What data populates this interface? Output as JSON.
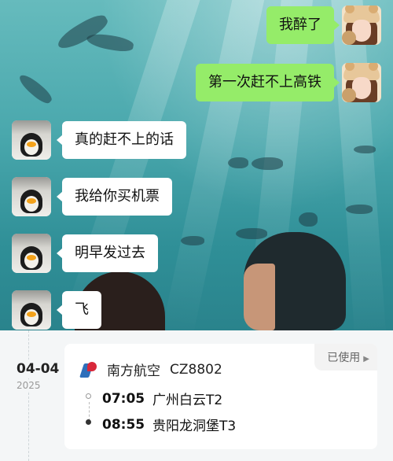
{
  "chat": {
    "messages": [
      {
        "sender": "me",
        "text": "我醉了"
      },
      {
        "sender": "me",
        "text": "第一次赶不上高铁"
      },
      {
        "sender": "them",
        "text": "真的赶不上的话"
      },
      {
        "sender": "them",
        "text": "我给你买机票"
      },
      {
        "sender": "them",
        "text": "明早发过去"
      },
      {
        "sender": "them",
        "text": "飞"
      }
    ],
    "colors": {
      "my_bubble": "#95ec69",
      "their_bubble": "#ffffff"
    }
  },
  "flight_record": {
    "date": "04-04",
    "year": "2025",
    "airline": "南方航空",
    "flight_number": "CZ8802",
    "status": "已使用",
    "departure": {
      "time": "07:05",
      "place": "广州白云T2"
    },
    "arrival": {
      "time": "08:55",
      "place": "贵阳龙洞堡T3"
    }
  }
}
